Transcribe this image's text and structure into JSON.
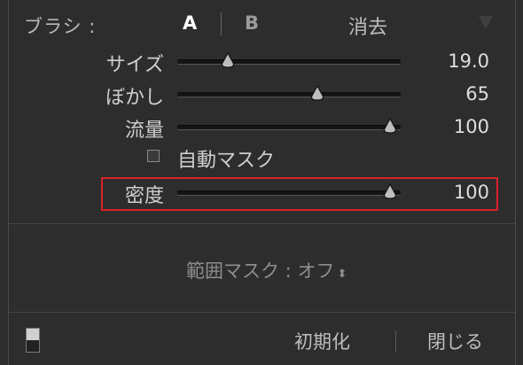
{
  "header": {
    "brush_label": "ブラシ :",
    "tab_a": "A",
    "tab_b": "B",
    "erase": "消去"
  },
  "sliders": [
    {
      "label": "サイズ",
      "value": "19.0",
      "position": 0.22
    },
    {
      "label": "ぼかし",
      "value": "65",
      "position": 0.65
    },
    {
      "label": "流量",
      "value": "100",
      "position": 1.0
    },
    {
      "label": "密度",
      "value": "100",
      "position": 1.0
    }
  ],
  "auto_mask": {
    "label": "自動マスク",
    "checked": false
  },
  "range_mask": {
    "label": "範囲マスク : オフ",
    "arrow": "⬍"
  },
  "footer": {
    "reset": "初期化",
    "close": "閉じる"
  },
  "colors": {
    "highlight": "#d9212a",
    "background": "#2d2d2d"
  }
}
